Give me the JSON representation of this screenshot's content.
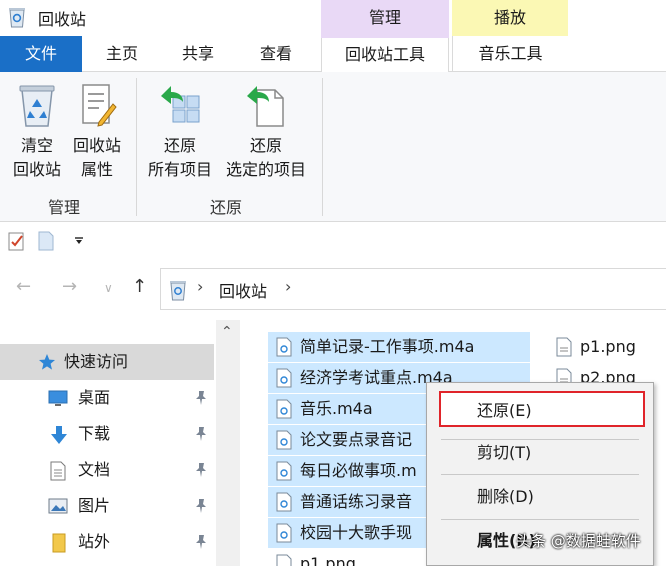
{
  "window": {
    "title": "回收站"
  },
  "context_tabs": {
    "manage": "管理",
    "play": "播放"
  },
  "tabs": {
    "file": "文件",
    "home": "主页",
    "share": "共享",
    "view": "查看",
    "recycle_tools": "回收站工具",
    "music_tools": "音乐工具"
  },
  "ribbon": {
    "empty_line1": "清空",
    "empty_line2": "回收站",
    "props_line1": "回收站",
    "props_line2": "属性",
    "restore_all_line1": "还原",
    "restore_all_line2": "所有项目",
    "restore_sel_line1": "还原",
    "restore_sel_line2": "选定的项目",
    "group_manage": "管理",
    "group_restore": "还原"
  },
  "address": {
    "path": "回收站"
  },
  "nav": {
    "items": [
      {
        "label": "快速访问",
        "icon": "star-icon"
      },
      {
        "label": "桌面",
        "icon": "desktop-icon",
        "pinned": true
      },
      {
        "label": "下载",
        "icon": "download-icon",
        "pinned": true
      },
      {
        "label": "文档",
        "icon": "document-icon",
        "pinned": true
      },
      {
        "label": "图片",
        "icon": "pictures-icon",
        "pinned": true
      },
      {
        "label": "站外",
        "icon": "folder-icon",
        "pinned": true
      }
    ]
  },
  "files": {
    "col1": [
      "简单记录-工作事项.m4a",
      "经济学考试重点.m4a",
      "音乐.m4a",
      "论文要点录音记",
      "每日必做事项.m",
      "普通话练习录音",
      "校园十大歌手现",
      "p1.png"
    ],
    "col2": [
      "p1.png",
      "p2.png"
    ]
  },
  "context_menu": {
    "restore": "还原(E)",
    "cut": "剪切(T)",
    "delete": "删除(D)",
    "properties": "属性(R)"
  },
  "watermark": "头条 @数据蛙软件",
  "colors": {
    "file_tab": "#1a6fc7",
    "manage_tab": "#e9d9f6",
    "play_tab": "#fbf8b4",
    "selection": "#cce8ff",
    "highlight_border": "#e0242a"
  }
}
